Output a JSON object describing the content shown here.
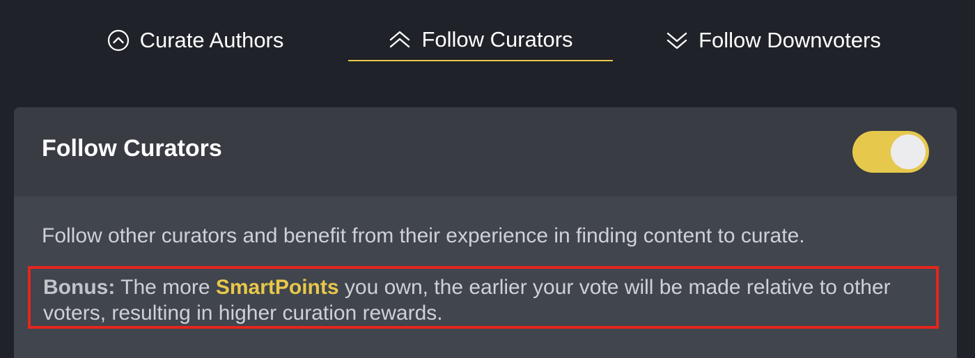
{
  "tabs": {
    "curate_authors": "Curate Authors",
    "follow_curators": "Follow Curators",
    "follow_downvoters": "Follow Downvoters",
    "active": "follow_curators",
    "accent_color": "#e8c84a"
  },
  "card": {
    "title": "Follow Curators",
    "toggle_on": true,
    "description": "Follow other curators and benefit from their experience in finding content to curate.",
    "bonus_label": "Bonus:",
    "bonus_pre": " The more ",
    "bonus_highlight": "SmartPoints",
    "bonus_post": " you own, the earlier your vote will be made relative to other voters, resulting in higher curation rewards."
  },
  "icons": {
    "curate": "circle-chevron-up-icon",
    "follow": "double-chevron-up-icon",
    "downvoters": "double-chevron-down-icon"
  }
}
